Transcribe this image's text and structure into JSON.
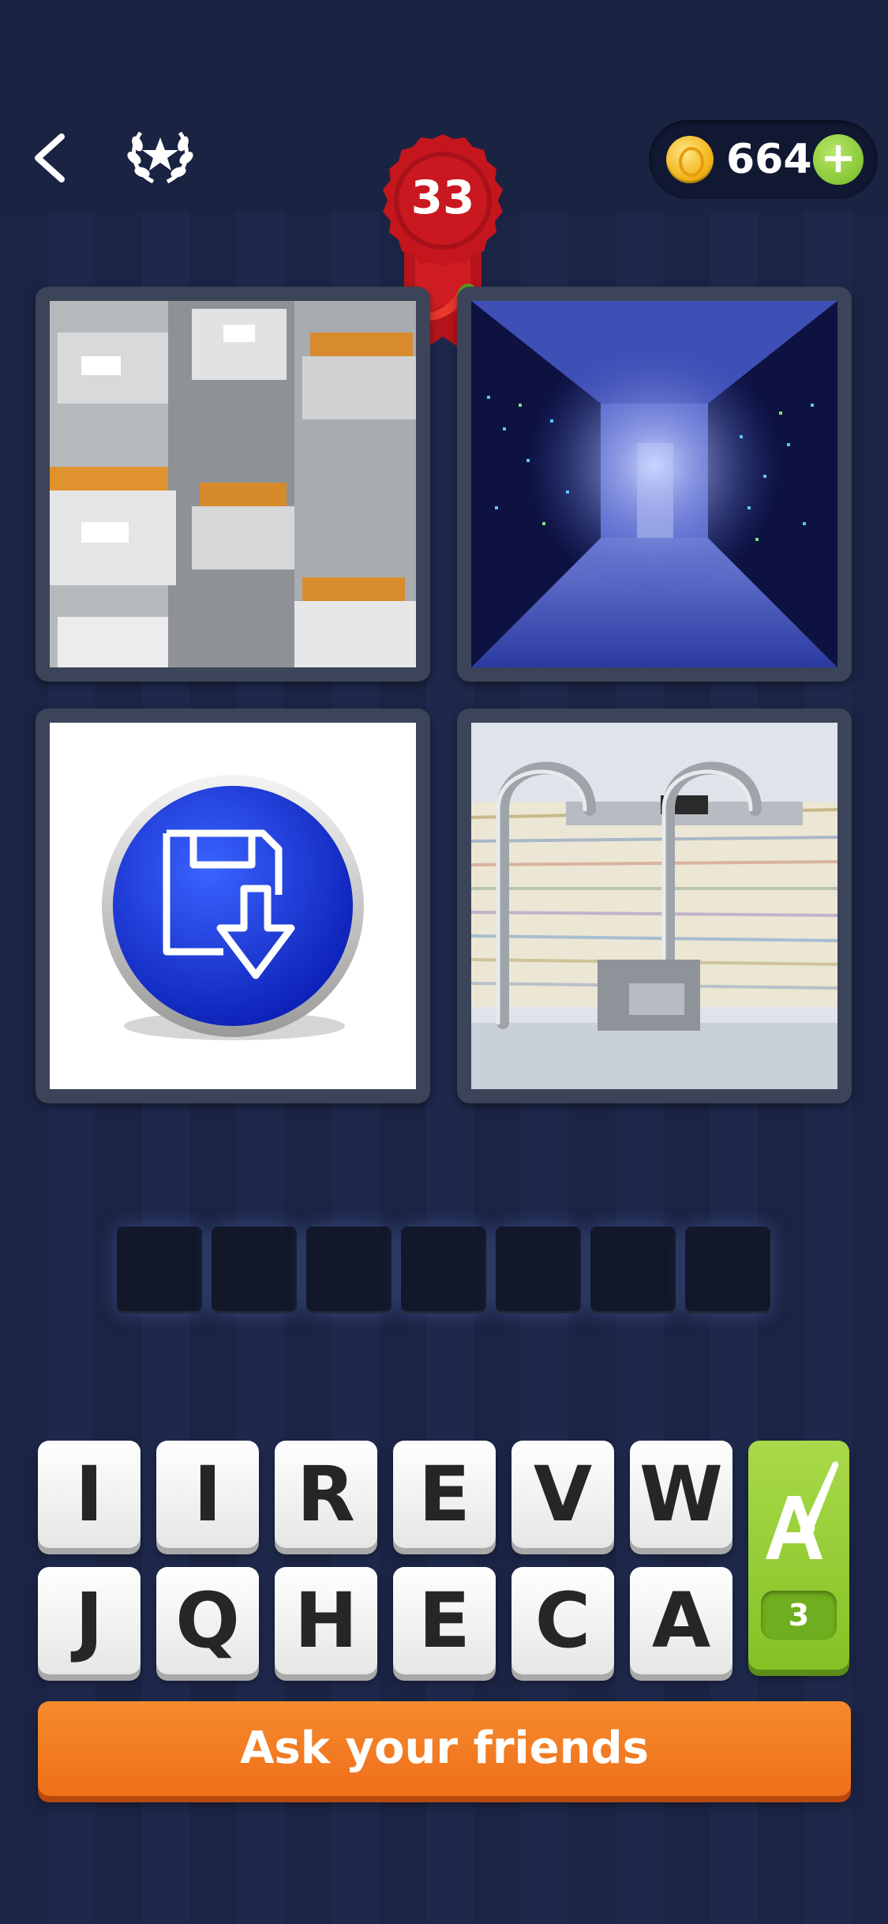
{
  "header": {
    "coins": "664",
    "plus_label": "+",
    "level": "33"
  },
  "images": [
    {
      "name": "filing-cabinets"
    },
    {
      "name": "server-room"
    },
    {
      "name": "save-icon"
    },
    {
      "name": "binder-papers"
    }
  ],
  "answer_slots": 7,
  "letters_row1": [
    "I",
    "I",
    "R",
    "E",
    "V",
    "W"
  ],
  "letters_row2": [
    "J",
    "Q",
    "H",
    "E",
    "C",
    "A"
  ],
  "hint": {
    "count": "3"
  },
  "ask_friends_label": "Ask your friends",
  "colors": {
    "background": "#1b2444",
    "accent_orange": "#ef6f1a",
    "accent_green": "#84c224",
    "ribbon_red": "#c4161c"
  }
}
